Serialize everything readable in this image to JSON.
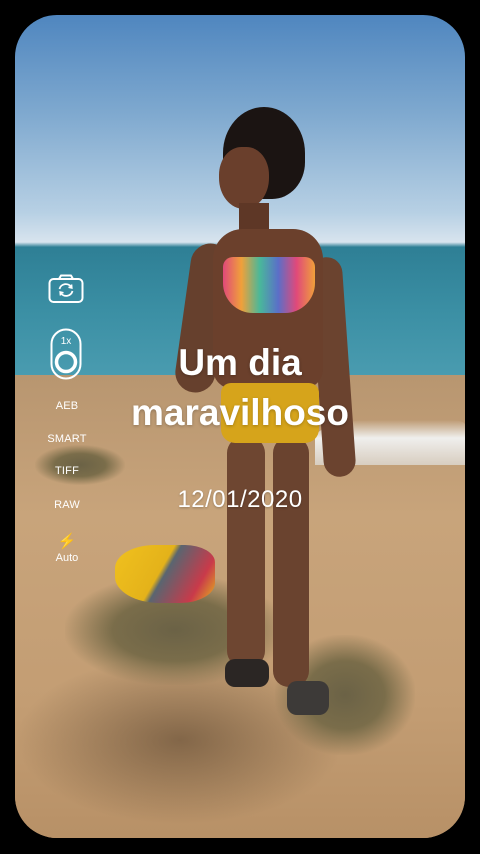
{
  "camera_controls": {
    "switch_icon": "camera-switch-icon",
    "lens_zoom": "1x",
    "options": [
      "AEB",
      "SMART",
      "TIFF",
      "RAW"
    ],
    "flash_icon": "flash-icon",
    "flash_mode": "Auto"
  },
  "overlay": {
    "title_line1": "Um dia",
    "title_line2": "maravilhoso",
    "date": "12/01/2020"
  },
  "colors": {
    "text": "#ffffff",
    "background": "#000000"
  }
}
